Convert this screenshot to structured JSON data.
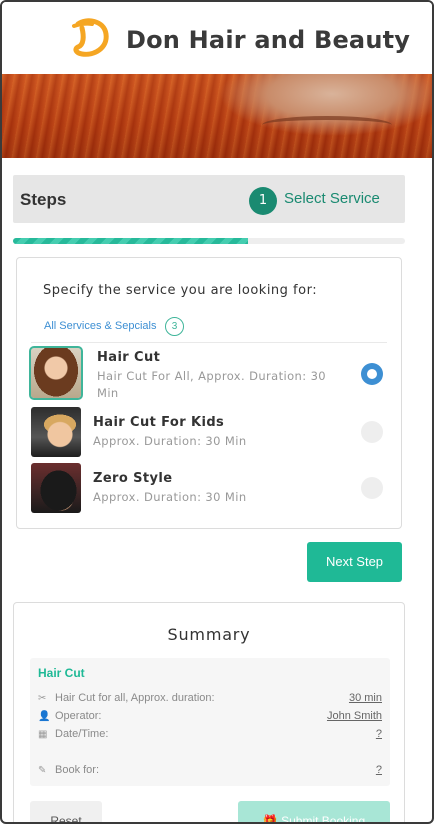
{
  "header": {
    "brand_name": "Don Hair and Beauty",
    "logo_icon": "d-letter-logo-icon"
  },
  "colors": {
    "accent": "#1fb996",
    "step_badge": "#1a8a71",
    "link": "#3d8fd3",
    "brand_logo": "#f5a623"
  },
  "steps": {
    "title": "Steps",
    "current_number": "1",
    "current_label": "Select Service",
    "progress_fraction": 0.6
  },
  "service_picker": {
    "prompt": "Specify the service you are looking for:",
    "all_services_label": "All Services & Sepcials",
    "count": "3",
    "services": [
      {
        "name": "Hair Cut",
        "description": "Hair Cut For All, Approx. Duration: 30 Min",
        "selected": true
      },
      {
        "name": "Hair Cut For Kids",
        "description": "Approx. Duration: 30 Min",
        "selected": false
      },
      {
        "name": "Zero Style",
        "description": "Approx. Duration: 30 Min",
        "selected": false
      }
    ]
  },
  "next_button_label": "Next Step",
  "summary": {
    "title": "Summary",
    "service": "Hair Cut",
    "rows": [
      {
        "label": "Hair Cut for all, Approx. duration:",
        "value": "30 min",
        "icon": "scissors-icon"
      },
      {
        "label": "Operator:",
        "value": "John Smith",
        "icon": "user-icon"
      },
      {
        "label": "Date/Time:",
        "value": "?",
        "icon": "calendar-icon"
      },
      {
        "label": "Book for:",
        "value": "?",
        "icon": "pencil-icon"
      }
    ],
    "reset_label": "Reset",
    "submit_label": "Submit Booking"
  }
}
